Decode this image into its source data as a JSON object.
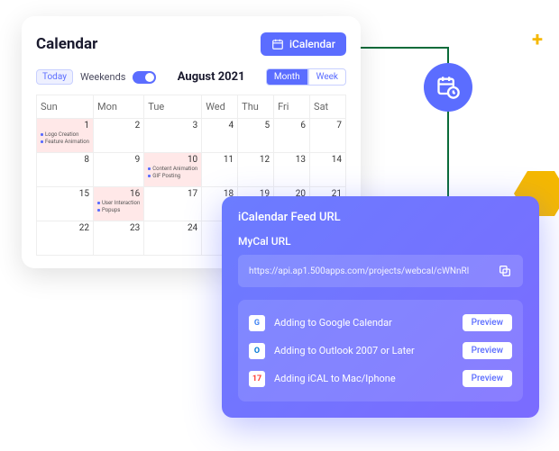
{
  "calendar": {
    "title": "Calendar",
    "icalendar_btn": "iCalendar",
    "today_btn": "Today",
    "weekends_label": "Weekends",
    "month_label": "August 2021",
    "view_month": "Month",
    "view_week": "Week",
    "headers": [
      "Sun",
      "Mon",
      "Tue",
      "Wed",
      "Thu",
      "Fri",
      "Sat"
    ],
    "weeks": [
      [
        {
          "n": "1",
          "pink": true,
          "ev": [
            "Logo Creation",
            "Feature Animation"
          ]
        },
        {
          "n": "2"
        },
        {
          "n": "3"
        },
        {
          "n": "4"
        },
        {
          "n": "5"
        },
        {
          "n": "6"
        },
        {
          "n": "7"
        }
      ],
      [
        {
          "n": "8"
        },
        {
          "n": "9"
        },
        {
          "n": "10",
          "pink": true,
          "ev": [
            "Content Animation",
            "GIF Posting"
          ]
        },
        {
          "n": "11"
        },
        {
          "n": "12"
        },
        {
          "n": "13"
        },
        {
          "n": "14"
        }
      ],
      [
        {
          "n": "15"
        },
        {
          "n": "16",
          "pink": true,
          "ev": [
            "User Interaction",
            "Popups"
          ]
        },
        {
          "n": "17"
        },
        {
          "n": "18"
        },
        {
          "n": "19"
        },
        {
          "n": "20"
        },
        {
          "n": "21"
        }
      ],
      [
        {
          "n": "22"
        },
        {
          "n": "23"
        },
        {
          "n": "24"
        },
        {
          "n": ""
        },
        {
          "n": ""
        },
        {
          "n": ""
        },
        {
          "n": ""
        }
      ]
    ]
  },
  "feed": {
    "title": "iCalendar Feed URL",
    "subtitle": "MyCal URL",
    "url": "https://api.ap1.500apps.com/projects/webcal/cWNnRl",
    "integrations": [
      {
        "icon": "g",
        "label": "Adding to Google Calendar",
        "btn": "Preview"
      },
      {
        "icon": "o",
        "label": "Adding to Outlook 2007 or Later",
        "btn": "Preview"
      },
      {
        "icon": "a",
        "label": "Adding iCAL to Mac/Iphone",
        "btn": "Preview"
      }
    ]
  }
}
